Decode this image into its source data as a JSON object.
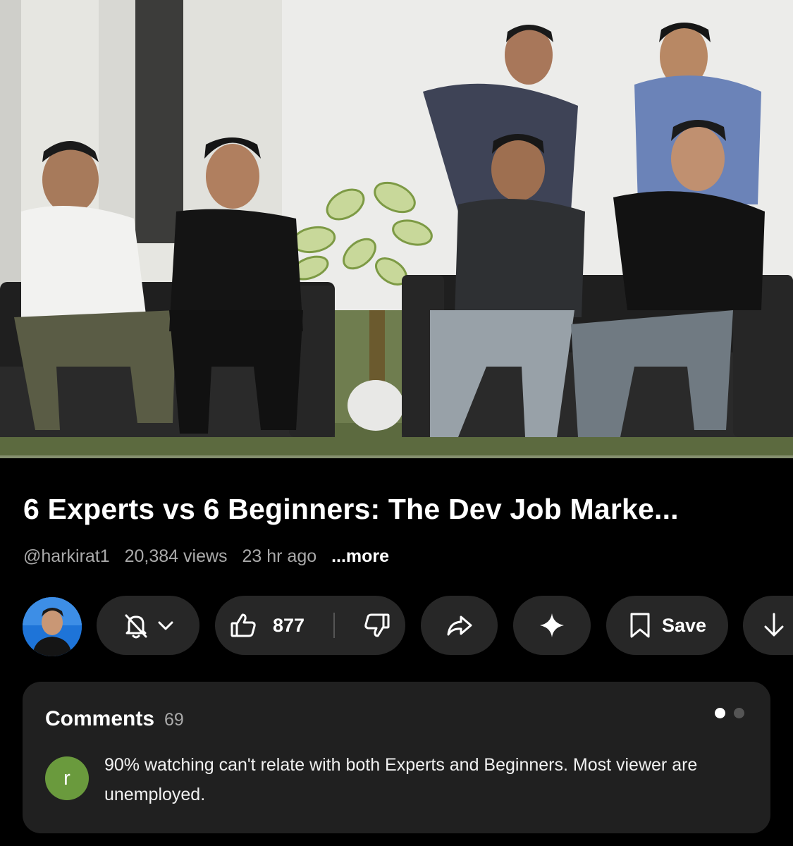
{
  "video": {
    "thumbnail_description_icon": "video-frame",
    "progress": 0.0
  },
  "title": "6 Experts vs 6 Beginners: The Dev Job Marke...",
  "meta": {
    "channel_handle": "@harkirat1",
    "views": "20,384 views",
    "uploaded": "23 hr ago",
    "more": "...more"
  },
  "actions": {
    "subscribe_bell_icon": "bell-off-icon",
    "like_count": "877",
    "like_icon": "thumbs-up-icon",
    "dislike_icon": "thumbs-down-icon",
    "share_icon": "share-arrow-icon",
    "ai_icon": "sparkle-icon",
    "save_label": "Save",
    "save_icon": "bookmark-icon",
    "download_icon": "download-arrow-icon"
  },
  "comments": {
    "title": "Comments",
    "count": "69",
    "pager_dots": 2,
    "active_dot": 0,
    "top_comment": {
      "avatar_letter": "r",
      "avatar_color": "#6a9a3d",
      "text": "90% watching can't relate with both Experts and Beginners. Most viewer are unemployed."
    }
  },
  "colors": {
    "background": "#000000",
    "pill": "#272727",
    "card": "#202020",
    "secondary_text": "#aaaaaa"
  }
}
